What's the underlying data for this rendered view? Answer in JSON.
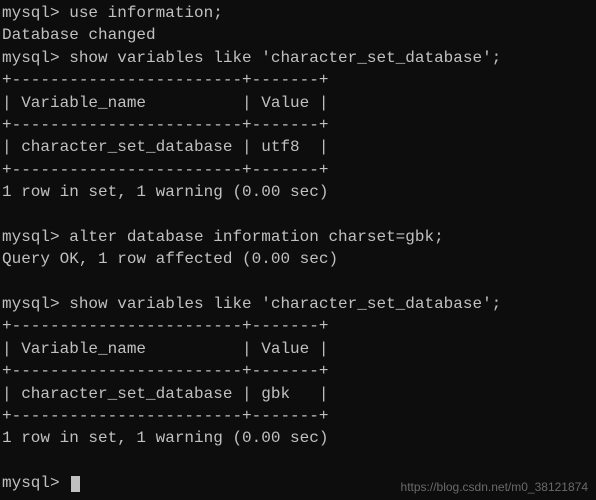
{
  "lines": {
    "l1_prompt": "mysql>",
    "l1_cmd": " use information;",
    "l2": "Database changed",
    "l3_prompt": "mysql>",
    "l3_cmd": " show variables like 'character_set_database';",
    "border_top1": "+------------------------+-------+",
    "header1": "| Variable_name          | Value |",
    "border_mid1": "+------------------------+-------+",
    "row1": "| character_set_database | utf8  |",
    "border_bot1": "+------------------------+-------+",
    "result1": "1 row in set, 1 warning (0.00 sec)",
    "blank": "",
    "l4_prompt": "mysql>",
    "l4_cmd": " alter database information charset=gbk;",
    "result2": "Query OK, 1 row affected (0.00 sec)",
    "l5_prompt": "mysql>",
    "l5_cmd": " show variables like 'character_set_database';",
    "border_top2": "+------------------------+-------+",
    "header2": "| Variable_name          | Value |",
    "border_mid2": "+------------------------+-------+",
    "row2": "| character_set_database | gbk   |",
    "border_bot2": "+------------------------+-------+",
    "result3": "1 row in set, 1 warning (0.00 sec)",
    "l6_prompt": "mysql>",
    "l6_cmd": " "
  },
  "watermark": "https://blog.csdn.net/m0_38121874"
}
